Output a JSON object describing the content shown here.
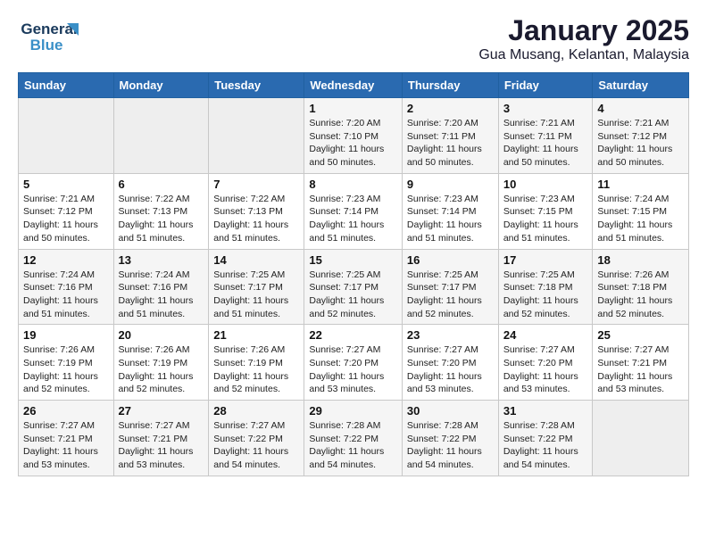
{
  "header": {
    "logo_line1": "General",
    "logo_line2": "Blue",
    "month": "January 2025",
    "location": "Gua Musang, Kelantan, Malaysia"
  },
  "weekdays": [
    "Sunday",
    "Monday",
    "Tuesday",
    "Wednesday",
    "Thursday",
    "Friday",
    "Saturday"
  ],
  "weeks": [
    [
      {
        "day": "",
        "info": ""
      },
      {
        "day": "",
        "info": ""
      },
      {
        "day": "",
        "info": ""
      },
      {
        "day": "1",
        "info": "Sunrise: 7:20 AM\nSunset: 7:10 PM\nDaylight: 11 hours\nand 50 minutes."
      },
      {
        "day": "2",
        "info": "Sunrise: 7:20 AM\nSunset: 7:11 PM\nDaylight: 11 hours\nand 50 minutes."
      },
      {
        "day": "3",
        "info": "Sunrise: 7:21 AM\nSunset: 7:11 PM\nDaylight: 11 hours\nand 50 minutes."
      },
      {
        "day": "4",
        "info": "Sunrise: 7:21 AM\nSunset: 7:12 PM\nDaylight: 11 hours\nand 50 minutes."
      }
    ],
    [
      {
        "day": "5",
        "info": "Sunrise: 7:21 AM\nSunset: 7:12 PM\nDaylight: 11 hours\nand 50 minutes."
      },
      {
        "day": "6",
        "info": "Sunrise: 7:22 AM\nSunset: 7:13 PM\nDaylight: 11 hours\nand 51 minutes."
      },
      {
        "day": "7",
        "info": "Sunrise: 7:22 AM\nSunset: 7:13 PM\nDaylight: 11 hours\nand 51 minutes."
      },
      {
        "day": "8",
        "info": "Sunrise: 7:23 AM\nSunset: 7:14 PM\nDaylight: 11 hours\nand 51 minutes."
      },
      {
        "day": "9",
        "info": "Sunrise: 7:23 AM\nSunset: 7:14 PM\nDaylight: 11 hours\nand 51 minutes."
      },
      {
        "day": "10",
        "info": "Sunrise: 7:23 AM\nSunset: 7:15 PM\nDaylight: 11 hours\nand 51 minutes."
      },
      {
        "day": "11",
        "info": "Sunrise: 7:24 AM\nSunset: 7:15 PM\nDaylight: 11 hours\nand 51 minutes."
      }
    ],
    [
      {
        "day": "12",
        "info": "Sunrise: 7:24 AM\nSunset: 7:16 PM\nDaylight: 11 hours\nand 51 minutes."
      },
      {
        "day": "13",
        "info": "Sunrise: 7:24 AM\nSunset: 7:16 PM\nDaylight: 11 hours\nand 51 minutes."
      },
      {
        "day": "14",
        "info": "Sunrise: 7:25 AM\nSunset: 7:17 PM\nDaylight: 11 hours\nand 51 minutes."
      },
      {
        "day": "15",
        "info": "Sunrise: 7:25 AM\nSunset: 7:17 PM\nDaylight: 11 hours\nand 52 minutes."
      },
      {
        "day": "16",
        "info": "Sunrise: 7:25 AM\nSunset: 7:17 PM\nDaylight: 11 hours\nand 52 minutes."
      },
      {
        "day": "17",
        "info": "Sunrise: 7:25 AM\nSunset: 7:18 PM\nDaylight: 11 hours\nand 52 minutes."
      },
      {
        "day": "18",
        "info": "Sunrise: 7:26 AM\nSunset: 7:18 PM\nDaylight: 11 hours\nand 52 minutes."
      }
    ],
    [
      {
        "day": "19",
        "info": "Sunrise: 7:26 AM\nSunset: 7:19 PM\nDaylight: 11 hours\nand 52 minutes."
      },
      {
        "day": "20",
        "info": "Sunrise: 7:26 AM\nSunset: 7:19 PM\nDaylight: 11 hours\nand 52 minutes."
      },
      {
        "day": "21",
        "info": "Sunrise: 7:26 AM\nSunset: 7:19 PM\nDaylight: 11 hours\nand 52 minutes."
      },
      {
        "day": "22",
        "info": "Sunrise: 7:27 AM\nSunset: 7:20 PM\nDaylight: 11 hours\nand 53 minutes."
      },
      {
        "day": "23",
        "info": "Sunrise: 7:27 AM\nSunset: 7:20 PM\nDaylight: 11 hours\nand 53 minutes."
      },
      {
        "day": "24",
        "info": "Sunrise: 7:27 AM\nSunset: 7:20 PM\nDaylight: 11 hours\nand 53 minutes."
      },
      {
        "day": "25",
        "info": "Sunrise: 7:27 AM\nSunset: 7:21 PM\nDaylight: 11 hours\nand 53 minutes."
      }
    ],
    [
      {
        "day": "26",
        "info": "Sunrise: 7:27 AM\nSunset: 7:21 PM\nDaylight: 11 hours\nand 53 minutes."
      },
      {
        "day": "27",
        "info": "Sunrise: 7:27 AM\nSunset: 7:21 PM\nDaylight: 11 hours\nand 53 minutes."
      },
      {
        "day": "28",
        "info": "Sunrise: 7:27 AM\nSunset: 7:22 PM\nDaylight: 11 hours\nand 54 minutes."
      },
      {
        "day": "29",
        "info": "Sunrise: 7:28 AM\nSunset: 7:22 PM\nDaylight: 11 hours\nand 54 minutes."
      },
      {
        "day": "30",
        "info": "Sunrise: 7:28 AM\nSunset: 7:22 PM\nDaylight: 11 hours\nand 54 minutes."
      },
      {
        "day": "31",
        "info": "Sunrise: 7:28 AM\nSunset: 7:22 PM\nDaylight: 11 hours\nand 54 minutes."
      },
      {
        "day": "",
        "info": ""
      }
    ]
  ]
}
